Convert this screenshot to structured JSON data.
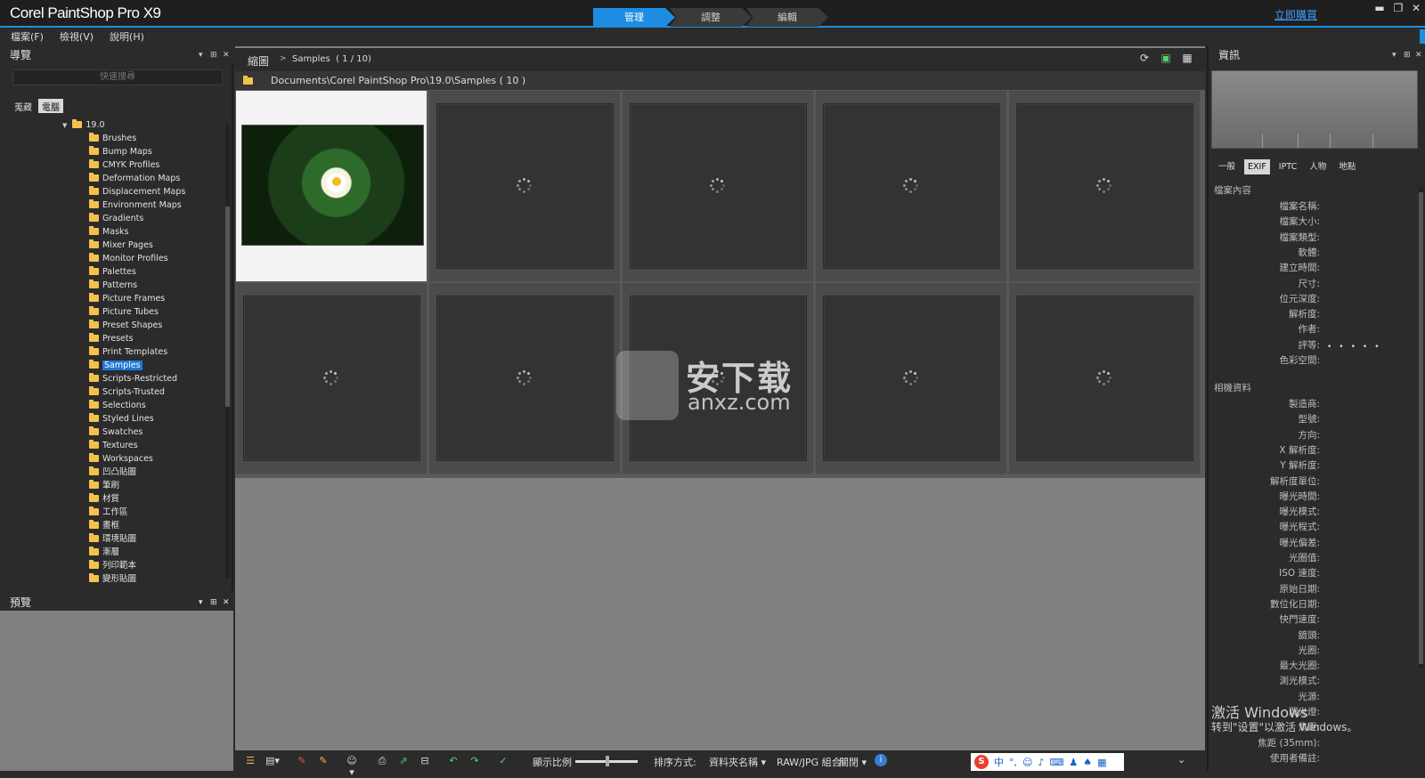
{
  "app": {
    "title": "Corel PaintShop Pro X9",
    "buy_now": "立即購買"
  },
  "mode_tabs": [
    {
      "label": "管理"
    },
    {
      "label": "調整"
    },
    {
      "label": "編輯"
    }
  ],
  "menu": [
    {
      "label": "檔案(F)"
    },
    {
      "label": "檢視(V)"
    },
    {
      "label": "說明(H)"
    }
  ],
  "nav_panel": {
    "title": "導覽",
    "search_placeholder": "快速搜尋",
    "tabs": [
      {
        "label": "蒐藏"
      },
      {
        "label": "電腦"
      }
    ],
    "root": "19.0",
    "folders": [
      "Brushes",
      "Bump Maps",
      "CMYK Profiles",
      "Deformation Maps",
      "Displacement Maps",
      "Environment Maps",
      "Gradients",
      "Masks",
      "Mixer Pages",
      "Monitor Profiles",
      "Palettes",
      "Patterns",
      "Picture Frames",
      "Picture Tubes",
      "Preset Shapes",
      "Presets",
      "Print Templates",
      "Samples",
      "Scripts-Restricted",
      "Scripts-Trusted",
      "Selections",
      "Styled Lines",
      "Swatches",
      "Textures",
      "Workspaces",
      "凹凸貼圖",
      "筆刷",
      "材質",
      "工作區",
      "畫框",
      "環境貼圖",
      "漸層",
      "列印範本",
      "變形貼圖"
    ],
    "selected": "Samples"
  },
  "preview_panel": {
    "title": "預覽"
  },
  "browser": {
    "view_label": "縮圖",
    "breadcrumb_sep": ">",
    "breadcrumb_folder": "Samples",
    "breadcrumb_count": "( 1 / 10)",
    "path": "Documents\\Corel PaintShop Pro\\19.0\\Samples ( 10 )",
    "thumbnail_count": 10
  },
  "status_bar": {
    "zoom_label": "顯示比例",
    "sort_label": "排序方式:",
    "sort_value": "資料夾名稱",
    "raw_label": "RAW/JPG 組合:",
    "raw_value": "關閉"
  },
  "info_panel": {
    "title": "資訊",
    "tabs": [
      {
        "label": "一般"
      },
      {
        "label": "EXIF"
      },
      {
        "label": "IPTC"
      },
      {
        "label": "人物"
      },
      {
        "label": "地點"
      }
    ],
    "active_tab": "EXIF",
    "file_section": "檔案內容",
    "file_fields": [
      "檔案名稱:",
      "檔案大小:",
      "檔案類型:",
      "軟體:",
      "建立時間:",
      "尺寸:",
      "位元深度:",
      "解析度:",
      "作者:",
      "評等:",
      "色彩空間:"
    ],
    "rating_dots": "•••••",
    "camera_section": "相機資料",
    "camera_fields": [
      "製造商:",
      "型號:",
      "方向:",
      "X 解析度:",
      "Y 解析度:",
      "解析度單位:",
      "曝光時間:",
      "曝光模式:",
      "曝光程式:",
      "曝光偏差:",
      "光圈值:",
      "ISO 速度:",
      "原始日期:",
      "數位化日期:",
      "快門速度:",
      "鏡頭:",
      "光圈:",
      "最大光圈:",
      "測光模式:",
      "光源:",
      "閃光燈:",
      "焦距:",
      "焦距 (35mm):",
      "使用者備註:"
    ]
  },
  "overlays": {
    "watermark_text": "安下载",
    "watermark_sub": "anxz.com",
    "activate_title": "激活 Windows",
    "activate_sub": "转到\"设置\"以激活 Windows。",
    "ime_label": "中"
  }
}
